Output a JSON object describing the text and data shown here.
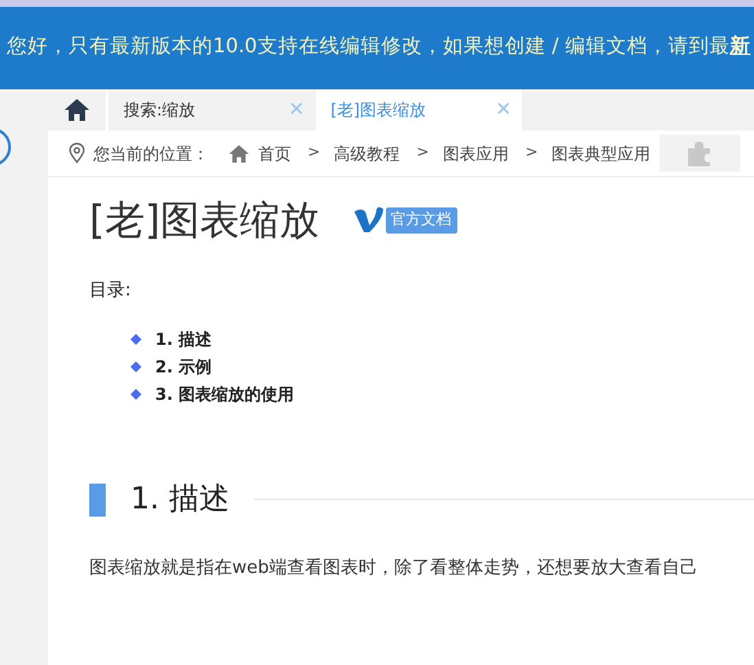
{
  "banner": {
    "text": "您好，只有最新版本的10.0支持在线编辑修改，如果想创建 / 编辑文档，请到最",
    "link": "新"
  },
  "tabs": [
    {
      "kind": "home",
      "selected": false
    },
    {
      "kind": "page",
      "label": "搜索:缩放",
      "selected": false,
      "close": "✕"
    },
    {
      "kind": "page",
      "label": "[老]图表缩放",
      "selected": true,
      "close": "✕"
    }
  ],
  "breadcrumb": {
    "label": "您当前的位置：",
    "items": [
      {
        "kind": "home",
        "text": "首页"
      },
      {
        "separator": ">",
        "text": "高级教程"
      },
      {
        "separator": ">",
        "text": "图表应用"
      },
      {
        "separator": ">",
        "text": "图表典型应用"
      }
    ]
  },
  "title": "[老]图表缩放",
  "badge": "官方文档",
  "toc": {
    "label": "目录:",
    "items": [
      "1. 描述",
      "2. 示例",
      "3. 图表缩放的使用"
    ]
  },
  "section": {
    "heading": "1. 描述",
    "paragraph": "图表缩放就是指在web端查看图表时，除了看整体走势，还想要放大查看自己"
  }
}
